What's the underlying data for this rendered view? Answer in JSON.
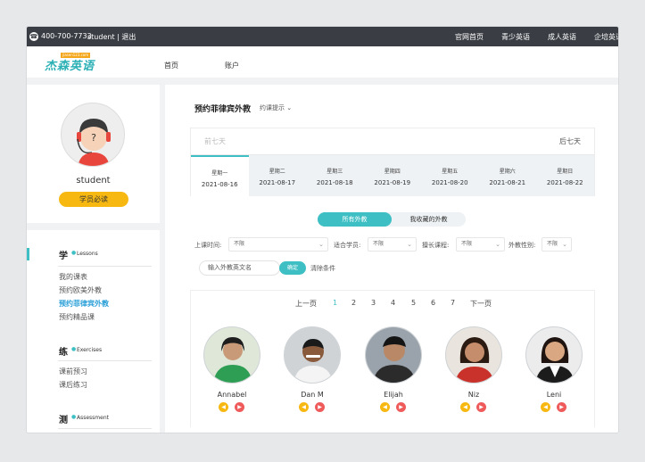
{
  "topbar": {
    "phone_icon": "☎",
    "phone": "400-700-7733",
    "user_text": "student | 退出",
    "links": [
      "官网首页",
      "青少英语",
      "成人英语",
      "企培英语"
    ]
  },
  "logo": {
    "main": "杰森英语",
    "small": "jiasen123.com"
  },
  "nav": {
    "home": "首页",
    "account": "账户"
  },
  "profile": {
    "username": "student",
    "must_read": "学员必读",
    "avatar_mark": "?"
  },
  "menu": {
    "lessons": {
      "big": "学",
      "en": "Lessons",
      "items": [
        "我的课表",
        "预约欧美外教",
        "预约菲律宾外教",
        "预约精品课"
      ]
    },
    "exercises": {
      "big": "练",
      "en": "Exercises",
      "items": [
        "课前预习",
        "课后练习"
      ]
    },
    "assessment": {
      "big": "测",
      "en": "Assessment"
    }
  },
  "main": {
    "title": "预约菲律宾外教",
    "tips": "约课提示",
    "prev_week": "前七天",
    "next_week": "后七天",
    "days": [
      {
        "week": "星期一",
        "date": "2021-08-16"
      },
      {
        "week": "星期二",
        "date": "2021-08-17"
      },
      {
        "week": "星期三",
        "date": "2021-08-18"
      },
      {
        "week": "星期四",
        "date": "2021-08-19"
      },
      {
        "week": "星期五",
        "date": "2021-08-20"
      },
      {
        "week": "星期六",
        "date": "2021-08-21"
      },
      {
        "week": "星期日",
        "date": "2021-08-22"
      }
    ],
    "toggle": {
      "all": "所有外教",
      "fav": "我收藏的外教"
    },
    "filters": {
      "time_label": "上课时间:",
      "time_value": "不限",
      "student_label": "适合学员:",
      "student_value": "不限",
      "course_label": "擅长课程:",
      "course_value": "不限",
      "gender_label": "外教性别:",
      "gender_value": "不限"
    },
    "search_placeholder": "输入外教英文名",
    "confirm": "确定",
    "clear": "清除条件",
    "pager": {
      "prev": "上一页",
      "next": "下一页",
      "pages": [
        "1",
        "2",
        "3",
        "4",
        "5",
        "6",
        "7"
      ]
    },
    "teachers": [
      {
        "name": "Annabel"
      },
      {
        "name": "Dan M"
      },
      {
        "name": "Elijah"
      },
      {
        "name": "Niz"
      },
      {
        "name": "Leni"
      }
    ]
  },
  "colors": {
    "accent": "#3ebfc4",
    "yellow": "#f7b812",
    "red": "#ef5a5a",
    "topbar": "#3a3e44"
  }
}
